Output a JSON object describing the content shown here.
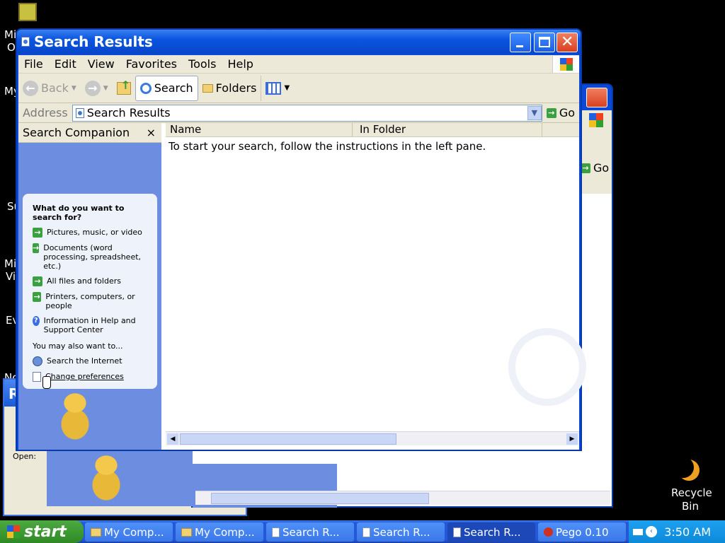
{
  "desktop": {
    "left_labels": [
      "Mi",
      "O",
      "My",
      "Su",
      "Mi",
      "Vi",
      "Ev",
      "Nc"
    ],
    "recycle_bin": {
      "line1": "Recycle",
      "line2": "Bin"
    }
  },
  "window": {
    "title": "Search Results",
    "menu": [
      "File",
      "Edit",
      "View",
      "Favorites",
      "Tools",
      "Help"
    ],
    "toolbar": {
      "back": "Back",
      "search": "Search",
      "folders": "Folders"
    },
    "address": {
      "label": "Address",
      "value": "Search Results",
      "go": "Go"
    },
    "companion": {
      "title": "Search Companion",
      "close": "×",
      "question": "What do you want to search for?",
      "options": [
        "Pictures, music, or video",
        "Documents (word processing, spreadsheet, etc.)",
        "All files and folders",
        "Printers, computers, or people",
        "Information in Help and Support Center"
      ],
      "also_heading": "You may also want to...",
      "also": [
        "Search the Internet",
        "Change preferences"
      ]
    },
    "columns": [
      "Name",
      "In Folder"
    ],
    "message": "To start your search, follow the instructions in the left pane."
  },
  "back_window": {
    "go": "Go"
  },
  "run_dialog": {
    "title_char": "R",
    "open_label": "Open:"
  },
  "taskbar": {
    "start": "start",
    "buttons": [
      "My Comp...",
      "My Comp...",
      "Search R...",
      "Search R...",
      "Search R...",
      "Pego 0.10"
    ],
    "clock": "3:50 AM"
  }
}
